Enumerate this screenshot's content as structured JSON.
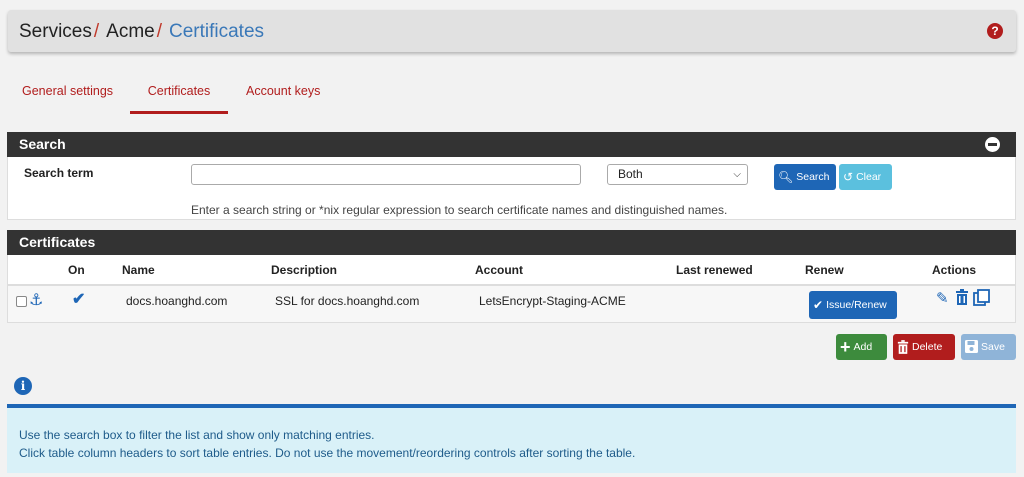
{
  "breadcrumb": {
    "services": "Services",
    "acme": "Acme",
    "current": "Certificates",
    "separator": "/"
  },
  "help_icon": "question-circle-icon",
  "tabs": [
    {
      "label": "General settings",
      "active": false
    },
    {
      "label": "Certificates",
      "active": true
    },
    {
      "label": "Account keys",
      "active": false
    }
  ],
  "search": {
    "title": "Search",
    "term_label": "Search term",
    "input_value": "",
    "select_value": "Both",
    "search_button": "Search",
    "clear_button": "Clear",
    "help_text": "Enter a search string or *nix regular expression to search certificate names and distinguished names."
  },
  "certificates": {
    "title": "Certificates",
    "columns": [
      "On",
      "Name",
      "Description",
      "Account",
      "Last renewed",
      "Renew",
      "Actions"
    ],
    "rows": [
      {
        "checked": false,
        "enabled": true,
        "name": "docs.hoanghd.com",
        "description": "SSL for docs.hoanghd.com",
        "account": "LetsEncrypt-Staging-ACME",
        "last_renewed": "",
        "renew_button": "Issue/Renew"
      }
    ]
  },
  "footer_buttons": {
    "add": "Add",
    "delete": "Delete",
    "save": "Save"
  },
  "info": {
    "line1": "Use the search box to filter the list and show only matching entries.",
    "line2": "Click table column headers to sort table entries. Do not use the movement/reordering controls after sorting the table."
  },
  "colors": {
    "primary": "#1e66b6",
    "danger": "#b11d1d",
    "success": "#3d8b3d",
    "info": "#5bc0de",
    "panel_head": "#333333"
  }
}
